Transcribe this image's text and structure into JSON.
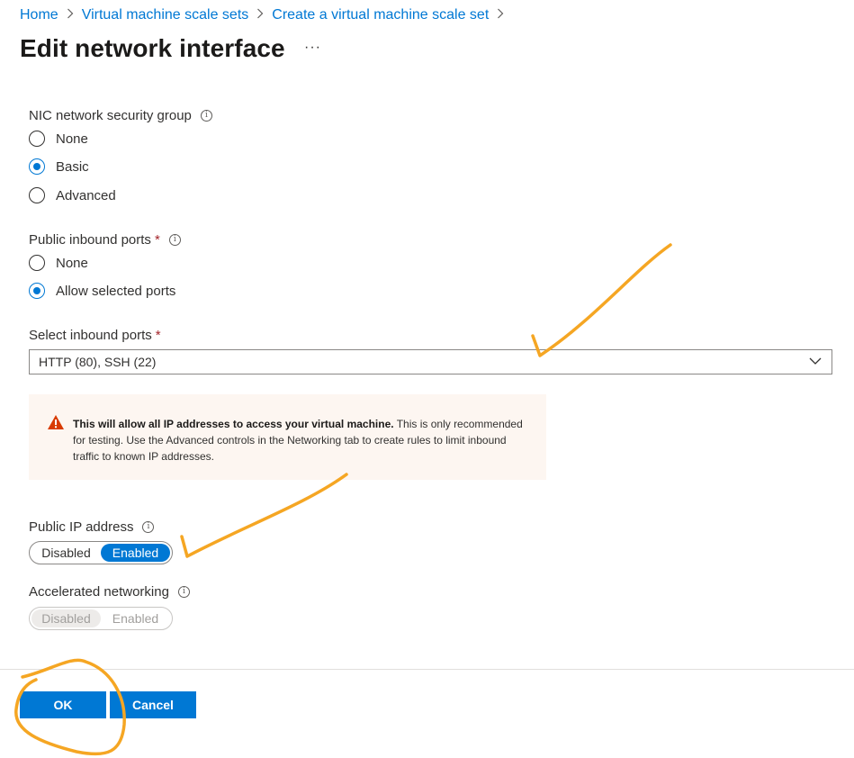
{
  "breadcrumb": [
    {
      "label": "Home"
    },
    {
      "label": "Virtual machine scale sets"
    },
    {
      "label": "Create a virtual machine scale set"
    }
  ],
  "page": {
    "title": "Edit network interface",
    "more_label": "···"
  },
  "nic_nsg": {
    "label": "NIC network security group",
    "options": [
      {
        "label": "None",
        "selected": false
      },
      {
        "label": "Basic",
        "selected": true
      },
      {
        "label": "Advanced",
        "selected": false
      }
    ]
  },
  "public_inbound_ports": {
    "label": "Public inbound ports",
    "required_mark": "*",
    "options": [
      {
        "label": "None",
        "selected": false
      },
      {
        "label": "Allow selected ports",
        "selected": true
      }
    ]
  },
  "select_inbound_ports": {
    "label": "Select inbound ports",
    "required_mark": "*",
    "value": "HTTP (80), SSH (22)"
  },
  "warning": {
    "bold": "This will allow all IP addresses to access your virtual machine.",
    "text": " This is only recommended for testing.  Use the Advanced controls in the Networking tab to create rules to limit inbound traffic to known IP addresses.",
    "color": "#d83b01"
  },
  "public_ip": {
    "label": "Public IP address",
    "options": [
      "Disabled",
      "Enabled"
    ],
    "selected": "Enabled"
  },
  "accelerated_networking": {
    "label": "Accelerated networking",
    "options": [
      "Disabled",
      "Enabled"
    ],
    "selected": "Disabled",
    "disabled": true
  },
  "footer": {
    "ok_label": "OK",
    "cancel_label": "Cancel"
  },
  "colors": {
    "accent": "#0078d4",
    "annotation": "#f5a623",
    "required": "#a4262c"
  }
}
